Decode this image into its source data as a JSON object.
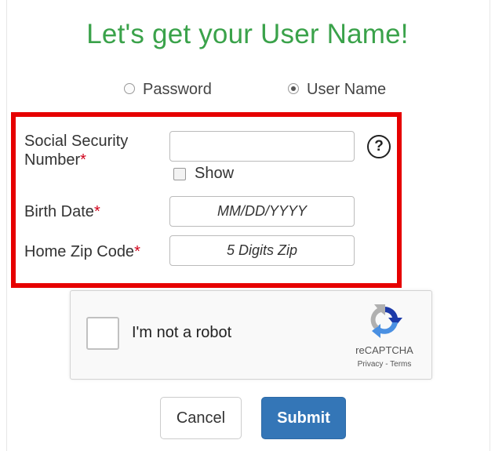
{
  "title": "Let's get your User Name!",
  "retrieval_options": {
    "password_label": "Password",
    "username_label": "User Name",
    "selected": "User Name"
  },
  "form": {
    "ssn_label_line1": "Social Security",
    "ssn_label_line2": "Number",
    "required_marker": "*",
    "ssn_value": "",
    "help_symbol": "?",
    "show_label": "Show",
    "birth_label": "Birth Date",
    "birth_placeholder": "MM/DD/YYYY",
    "zip_label": "Home Zip Code",
    "zip_placeholder": "5 Digits Zip"
  },
  "captcha": {
    "label": "I'm not a robot",
    "brand": "reCAPTCHA",
    "links": "Privacy - Terms"
  },
  "buttons": {
    "cancel": "Cancel",
    "submit": "Submit"
  },
  "colors": {
    "title": "#3aa24a",
    "highlight": "#e60000",
    "submit": "#3476b7"
  }
}
